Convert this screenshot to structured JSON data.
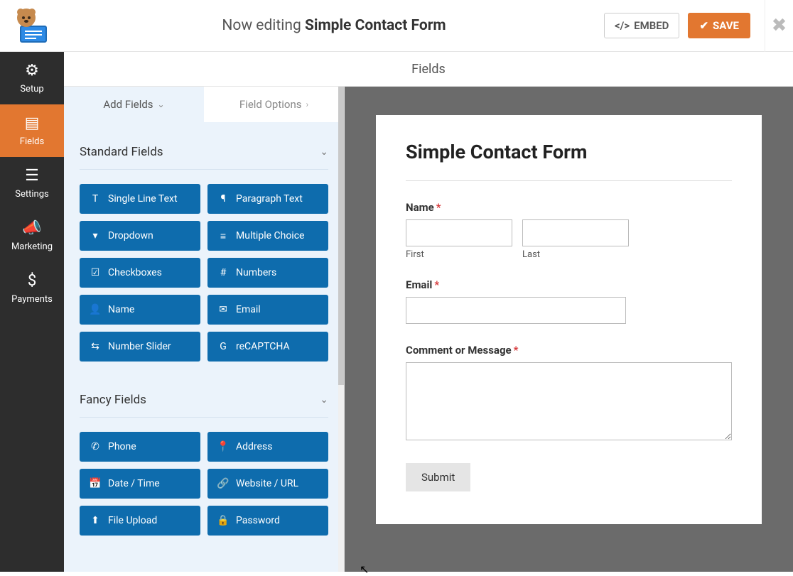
{
  "header": {
    "editing_prefix": "Now editing ",
    "form_name": "Simple Contact Form",
    "embed_label": "EMBED",
    "save_label": "SAVE"
  },
  "leftnav": {
    "items": [
      {
        "label": "Setup",
        "icon": "⚙"
      },
      {
        "label": "Fields",
        "icon": "▤"
      },
      {
        "label": "Settings",
        "icon": "☰"
      },
      {
        "label": "Marketing",
        "icon": "📣"
      },
      {
        "label": "Payments",
        "icon": "$"
      }
    ],
    "active_index": 1
  },
  "subhead": {
    "label": "Fields"
  },
  "panel": {
    "tabs": {
      "add": "Add Fields",
      "options": "Field Options"
    },
    "standard": {
      "title": "Standard Fields",
      "fields": [
        {
          "label": "Single Line Text",
          "icon": "T"
        },
        {
          "label": "Paragraph Text",
          "icon": "¶"
        },
        {
          "label": "Dropdown",
          "icon": "▾"
        },
        {
          "label": "Multiple Choice",
          "icon": "≡"
        },
        {
          "label": "Checkboxes",
          "icon": "☑"
        },
        {
          "label": "Numbers",
          "icon": "#"
        },
        {
          "label": "Name",
          "icon": "👤"
        },
        {
          "label": "Email",
          "icon": "✉"
        },
        {
          "label": "Number Slider",
          "icon": "⇆"
        },
        {
          "label": "reCAPTCHA",
          "icon": "G"
        }
      ]
    },
    "fancy": {
      "title": "Fancy Fields",
      "fields": [
        {
          "label": "Phone",
          "icon": "✆"
        },
        {
          "label": "Address",
          "icon": "📍"
        },
        {
          "label": "Date / Time",
          "icon": "📅"
        },
        {
          "label": "Website / URL",
          "icon": "🔗"
        },
        {
          "label": "File Upload",
          "icon": "⬆"
        },
        {
          "label": "Password",
          "icon": "🔒"
        }
      ]
    }
  },
  "preview": {
    "form_title": "Simple Contact Form",
    "name_label": "Name",
    "first_sublabel": "First",
    "last_sublabel": "Last",
    "email_label": "Email",
    "comment_label": "Comment or Message",
    "submit_label": "Submit"
  }
}
